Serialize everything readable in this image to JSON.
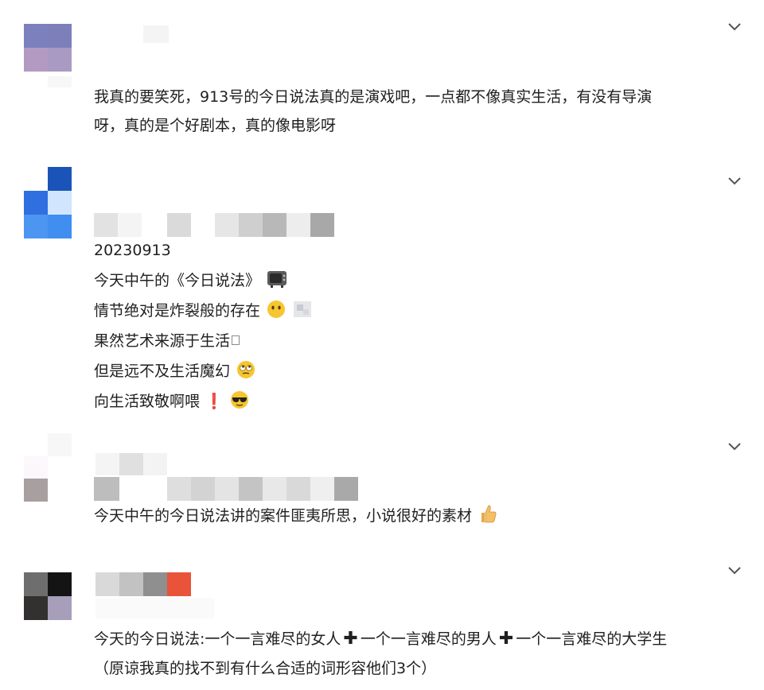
{
  "comments": [
    {
      "lines": [
        "我真的要笑死，913号的今日说法真的是演戏吧，一点都不像真实生活，有没有导演",
        "呀，真的是个好剧本，真的像电影呀"
      ]
    },
    {
      "lines": [
        "20230913",
        "今天中午的《今日说法》",
        "情节绝对是炸裂般的存在",
        "果然艺术来源于生活",
        "但是远不及生活魔幻",
        "向生活致敬啊喂"
      ],
      "exclaim": "❗"
    },
    {
      "lines": [
        "今天中午的今日说法讲的案件匪夷所思，小说很好的素材"
      ]
    },
    {
      "lines": [
        "今天的今日说法:一个一言难尽的女人",
        "一个一言难尽的男人",
        "一个一言难尽的大学生",
        "（原谅我真的找不到有什么合适的词形容他们3个）"
      ],
      "plus": "✚"
    }
  ],
  "icons": {
    "expand": "chevron-down-icon",
    "emoji_tv": "tv-icon",
    "emoji_neutral": "neutral-face-icon",
    "emoji_rolling_eyes": "rolling-eyes-face-icon",
    "emoji_sunglasses": "sunglasses-face-icon",
    "emoji_thumbs_up": "thumbs-up-icon"
  },
  "colors": {
    "text": "#1f1f1f",
    "exclaim": "#e0281e",
    "background": "#ffffff"
  }
}
